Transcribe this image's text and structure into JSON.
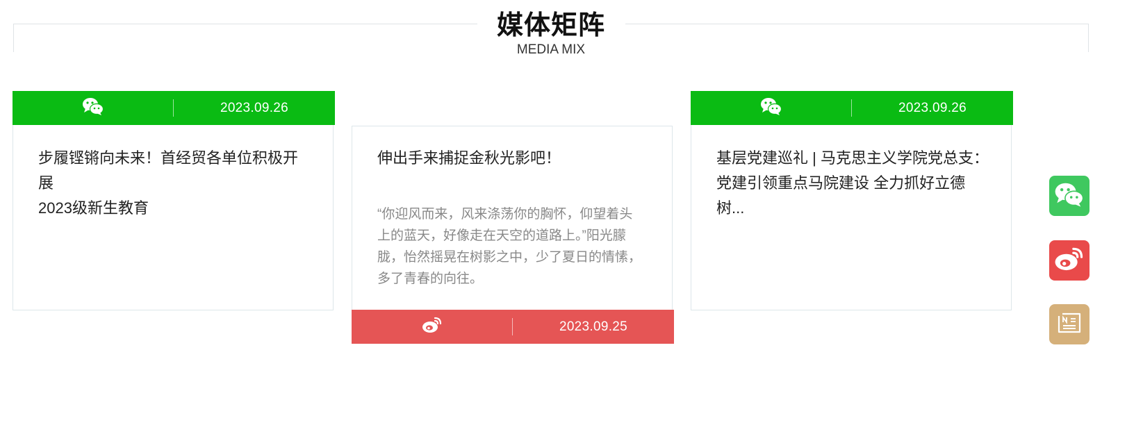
{
  "section": {
    "title": "媒体矩阵",
    "subtitle": "MEDIA MIX"
  },
  "cards": [
    {
      "platform": "wechat",
      "date": "2023.09.26",
      "title_line1": "步履铿锵向未来！首经贸各单位积极开展",
      "title_line2": "2023级新生教育",
      "bar_color": "#0abb13"
    },
    {
      "platform": "weibo",
      "date": "2023.09.25",
      "title_line1": "伸出手来捕捉金秋光影吧！",
      "summary_lines": [
        "“你迎风而来，风来涤荡你的胸怀，仰望着头",
        "上的蓝天，好像走在天空的道路上。”阳光朦",
        "胧，怡然摇晃在树影之中，少了夏日的情愫，",
        "多了青春的向往。"
      ],
      "bar_color": "#e55555"
    },
    {
      "platform": "wechat",
      "date": "2023.09.26",
      "title_line1": "基层党建巡礼 | 马克思主义学院党总支：",
      "title_line2": "党建引领重点马院建设 全力抓好立德树...",
      "bar_color": "#0abb13"
    }
  ],
  "side_buttons": [
    {
      "icon": "wechat-icon",
      "color": "#3fc85f"
    },
    {
      "icon": "weibo-icon",
      "color": "#e94a4a"
    },
    {
      "icon": "news-icon",
      "color": "#d5b07a"
    }
  ]
}
